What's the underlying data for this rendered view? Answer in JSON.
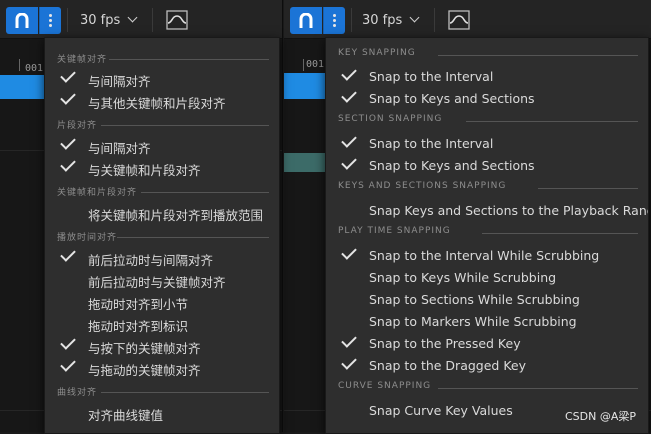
{
  "toolbar_left": {
    "fps_label": "30 fps",
    "frame_label": "001"
  },
  "toolbar_right": {
    "fps_label": "30 fps",
    "frame_label": "001"
  },
  "menu_cn": {
    "sections": [
      {
        "label": "关键帧对齐",
        "items": [
          {
            "label": "与间隔对齐",
            "checked": true
          },
          {
            "label": "与其他关键帧和片段对齐",
            "checked": true
          }
        ]
      },
      {
        "label": "片段对齐",
        "items": [
          {
            "label": "与间隔对齐",
            "checked": true
          },
          {
            "label": "与关键帧和片段对齐",
            "checked": true
          }
        ]
      },
      {
        "label": "关键帧和片段对齐",
        "items": [
          {
            "label": "将关键帧和片段对齐到播放范围",
            "checked": false
          }
        ]
      },
      {
        "label": "播放时间对齐",
        "items": [
          {
            "label": "前后拉动时与间隔对齐",
            "checked": true
          },
          {
            "label": "前后拉动时与关键帧对齐",
            "checked": false
          },
          {
            "label": "拖动时对齐到小节",
            "checked": false
          },
          {
            "label": "拖动时对齐到标识",
            "checked": false
          },
          {
            "label": "与按下的关键帧对齐",
            "checked": true
          },
          {
            "label": "与拖动的关键帧对齐",
            "checked": true
          }
        ]
      },
      {
        "label": "曲线对齐",
        "items": [
          {
            "label": "对齐曲线键值",
            "checked": false
          }
        ]
      }
    ]
  },
  "menu_en": {
    "sections": [
      {
        "label": "KEY SNAPPING",
        "items": [
          {
            "label": "Snap to the Interval",
            "checked": true
          },
          {
            "label": "Snap to Keys and Sections",
            "checked": true
          }
        ]
      },
      {
        "label": "SECTION SNAPPING",
        "items": [
          {
            "label": "Snap to the Interval",
            "checked": true
          },
          {
            "label": "Snap to Keys and Sections",
            "checked": true
          }
        ]
      },
      {
        "label": "KEYS AND SECTIONS SNAPPING",
        "items": [
          {
            "label": "Snap Keys and Sections to the Playback Range",
            "checked": false
          }
        ]
      },
      {
        "label": "PLAY TIME SNAPPING",
        "items": [
          {
            "label": "Snap to the Interval While Scrubbing",
            "checked": true
          },
          {
            "label": "Snap to Keys While Scrubbing",
            "checked": false
          },
          {
            "label": "Snap to Sections While Scrubbing",
            "checked": false
          },
          {
            "label": "Snap to Markers While Scrubbing",
            "checked": false
          },
          {
            "label": "Snap to the Pressed Key",
            "checked": true
          },
          {
            "label": "Snap to the Dragged Key",
            "checked": true
          }
        ]
      },
      {
        "label": "CURVE SNAPPING",
        "items": [
          {
            "label": "Snap Curve Key Values",
            "checked": false
          }
        ]
      }
    ]
  },
  "watermark": "CSDN @A梁P",
  "colors": {
    "accent": "#1b74d6",
    "menu_bg": "#2e2e2e",
    "timeline_bar": "#1f8be3",
    "section_bar": "#3c6b68"
  }
}
